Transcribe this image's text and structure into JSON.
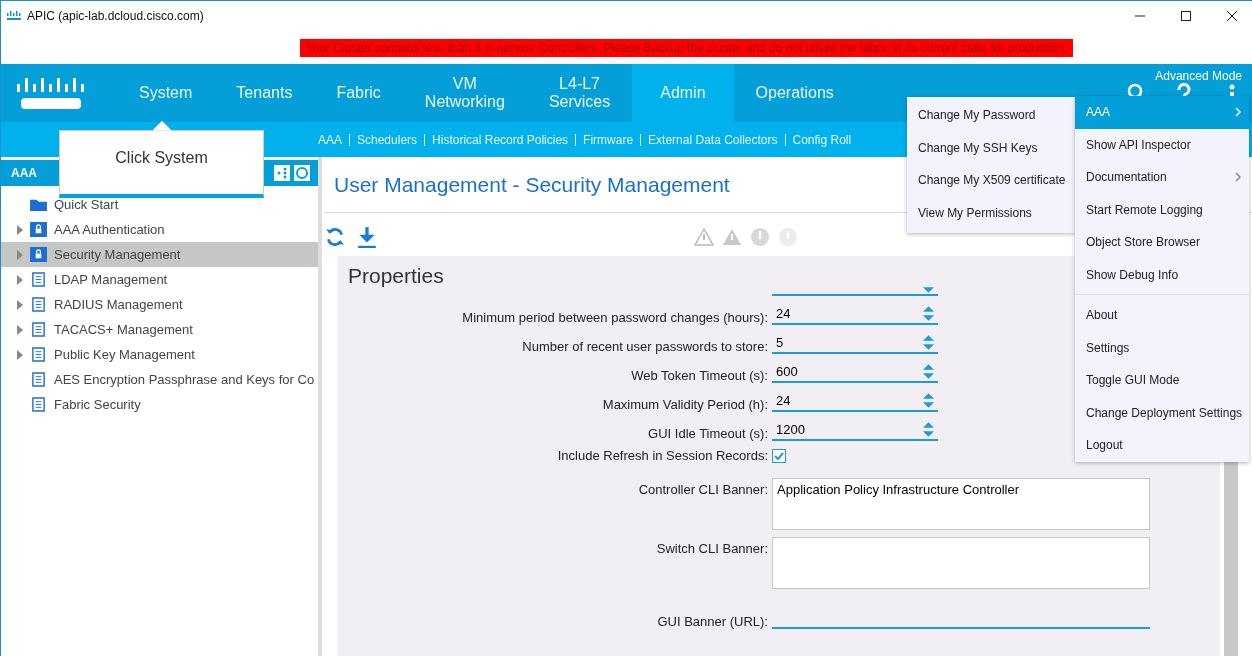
{
  "window": {
    "title": "APIC (apic-lab.dcloud.cisco.com)"
  },
  "banner": "Your Cluster contains less than 3 in-service Controllers. Please Backup the cluster and do not utilize the fabric in its current state for production.",
  "nav": [
    {
      "label": "System",
      "selected": false
    },
    {
      "label": "Tenants",
      "selected": false
    },
    {
      "label": "Fabric",
      "selected": false
    },
    {
      "label": "VM Networking",
      "selected": false
    },
    {
      "label": "L4-L7 Services",
      "selected": false
    },
    {
      "label": "Admin",
      "selected": true
    },
    {
      "label": "Operations",
      "selected": false
    }
  ],
  "mode": "Advanced Mode",
  "subnav": [
    "AAA",
    "Schedulers",
    "Historical Record Policies",
    "Firmware",
    "External Data Collectors",
    "Config Roll"
  ],
  "callout": "Click System",
  "sidebar": {
    "title": "AAA",
    "items": [
      {
        "label": "Quick Start",
        "kind": "folder",
        "expandable": false,
        "selected": false
      },
      {
        "label": "AAA Authentication",
        "kind": "lock",
        "expandable": true,
        "selected": false
      },
      {
        "label": "Security Management",
        "kind": "lock",
        "expandable": true,
        "selected": true
      },
      {
        "label": "LDAP Management",
        "kind": "doc",
        "expandable": true,
        "selected": false
      },
      {
        "label": "RADIUS Management",
        "kind": "doc",
        "expandable": true,
        "selected": false
      },
      {
        "label": "TACACS+ Management",
        "kind": "doc",
        "expandable": true,
        "selected": false
      },
      {
        "label": "Public Key Management",
        "kind": "doc",
        "expandable": true,
        "selected": false
      },
      {
        "label": "AES Encryption Passphrase and Keys for Co",
        "kind": "doc",
        "expandable": false,
        "selected": false
      },
      {
        "label": "Fabric Security",
        "kind": "doc",
        "expandable": false,
        "selected": false
      }
    ]
  },
  "page_title": "User Management - Security Management",
  "properties": {
    "title": "Properties",
    "rows": [
      {
        "kind": "spinner",
        "label": "Minimum period between password changes (hours):",
        "value": "24"
      },
      {
        "kind": "spinner",
        "label": "Number of recent user passwords to store:",
        "value": "5"
      },
      {
        "kind": "spinner",
        "label": "Web Token Timeout (s):",
        "value": "600"
      },
      {
        "kind": "spinner",
        "label": "Maximum Validity Period (h):",
        "value": "24"
      },
      {
        "kind": "spinner",
        "label": "GUI Idle Timeout (s):",
        "value": "1200"
      },
      {
        "kind": "checkbox",
        "label": "Include Refresh in Session Records:",
        "checked": true
      },
      {
        "kind": "textarea",
        "label": "Controller CLI Banner:",
        "value": "Application Policy Infrastructure Controller"
      },
      {
        "kind": "textarea",
        "label": "Switch CLI Banner:"
      },
      {
        "kind": "text",
        "label": "GUI Banner (URL):"
      }
    ]
  },
  "user_menu": [
    "Change My Password",
    "Change My SSH Keys",
    "Change My X509 certificate",
    "View My Permissions"
  ],
  "main_menu": [
    [
      {
        "label": "AAA",
        "selected": true,
        "submenu": true
      },
      {
        "label": "Show API Inspector",
        "selected": false,
        "submenu": false
      },
      {
        "label": "Documentation",
        "selected": false,
        "submenu": true
      },
      {
        "label": "Start Remote Logging",
        "selected": false,
        "submenu": false
      },
      {
        "label": "Object Store Browser",
        "selected": false,
        "submenu": false
      },
      {
        "label": "Show Debug Info",
        "selected": false,
        "submenu": false
      }
    ],
    [
      {
        "label": "About",
        "selected": false,
        "submenu": false
      },
      {
        "label": "Settings",
        "selected": false,
        "submenu": false
      },
      {
        "label": "Toggle GUI Mode",
        "selected": false,
        "submenu": false
      },
      {
        "label": "Change Deployment Settings",
        "selected": false,
        "submenu": false
      },
      {
        "label": "Logout",
        "selected": false,
        "submenu": false
      }
    ]
  ]
}
